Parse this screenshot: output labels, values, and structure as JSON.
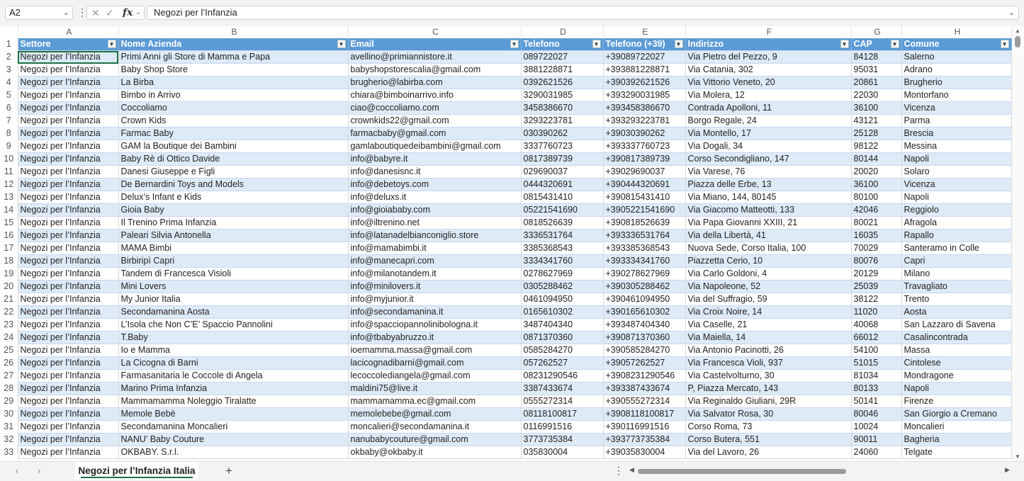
{
  "formula_bar": {
    "cell_ref": "A2",
    "formula": "Negozi per l’Infanzia"
  },
  "columns": [
    "A",
    "B",
    "C",
    "D",
    "E",
    "F",
    "G",
    "H"
  ],
  "header_row_number": "1",
  "headers": [
    "Settore",
    "Nome Azienda",
    "Email",
    "Telefono",
    "Telefono (+39)",
    "Indirizzo",
    "CAP",
    "Comune"
  ],
  "rows": [
    {
      "n": "2",
      "cells": [
        "Negozi per l’Infanzia",
        "Primi Anni gli Store di Mamma e Papa",
        "avellino@primiannistore.it",
        "089722027",
        "+39089722027",
        "Via Pietro del Pezzo, 9",
        "84128",
        "Salerno"
      ]
    },
    {
      "n": "3",
      "cells": [
        "Negozi per l’Infanzia",
        "Baby Shop Store",
        "babyshopstorescalia@gmail.com",
        "3881228871",
        "+393881228871",
        "Via Catania, 302",
        "95031",
        "Adrano"
      ]
    },
    {
      "n": "4",
      "cells": [
        "Negozi per l’Infanzia",
        "La Birba",
        "brugherio@labirba.com",
        "0392621526",
        "+390392621526",
        "Via Vittorio Veneto, 20",
        "20861",
        "Brugherio"
      ]
    },
    {
      "n": "5",
      "cells": [
        "Negozi per l’Infanzia",
        "Bimbo in Arrivo",
        "chiara@bimboinarrivo.info",
        "3290031985",
        "+393290031985",
        "Via Molera, 12",
        "22030",
        "Montorfano"
      ]
    },
    {
      "n": "6",
      "cells": [
        "Negozi per l’Infanzia",
        "Coccoliamo",
        "ciao@coccoliamo.com",
        "3458386670",
        "+393458386670",
        "Contrada Apolloni, 11",
        "36100",
        "Vicenza"
      ]
    },
    {
      "n": "7",
      "cells": [
        "Negozi per l’Infanzia",
        "Crown Kids",
        "crownkids22@gmail.com",
        "3293223781",
        "+393293223781",
        "Borgo Regale, 24",
        "43121",
        "Parma"
      ]
    },
    {
      "n": "8",
      "cells": [
        "Negozi per l’Infanzia",
        "Farmac Baby",
        "farmacbaby@gmail.com",
        "030390262",
        "+39030390262",
        "Via Montello, 17",
        "25128",
        "Brescia"
      ]
    },
    {
      "n": "9",
      "cells": [
        "Negozi per l’Infanzia",
        "GAM la Boutique dei Bambini",
        "gamlaboutiquedeibambini@gmail.com",
        "3337760723",
        "+393337760723",
        "Via Dogali, 34",
        "98122",
        "Messina"
      ]
    },
    {
      "n": "10",
      "cells": [
        "Negozi per l’Infanzia",
        "Baby Rè di Ottico Davide",
        "info@babyre.it",
        "0817389739",
        "+390817389739",
        "Corso Secondigliano, 147",
        "80144",
        "Napoli"
      ]
    },
    {
      "n": "11",
      "cells": [
        "Negozi per l’Infanzia",
        "Danesi Giuseppe e Figli",
        "info@danesisnc.it",
        "029690037",
        "+39029690037",
        "Via Varese, 76",
        "20020",
        "Solaro"
      ]
    },
    {
      "n": "12",
      "cells": [
        "Negozi per l’Infanzia",
        "De Bernardini Toys and Models",
        "info@debetoys.com",
        "0444320691",
        "+390444320691",
        "Piazza delle Erbe, 13",
        "36100",
        "Vicenza"
      ]
    },
    {
      "n": "13",
      "cells": [
        "Negozi per l’Infanzia",
        "Delux’s Infant e Kids",
        "info@deluxs.it",
        "0815431410",
        "+390815431410",
        "Via Miano, 144, 80145",
        "80100",
        "Napoli"
      ]
    },
    {
      "n": "14",
      "cells": [
        "Negozi per l’Infanzia",
        "Gioia Baby",
        "info@gioiababy.com",
        "05221541690",
        "+3905221541690",
        "Via Giacomo Matteotti, 133",
        "42046",
        "Reggiolo"
      ]
    },
    {
      "n": "15",
      "cells": [
        "Negozi per l’Infanzia",
        "Il Trenino Prima Infanzia",
        "info@iltrenino.net",
        "0818526639",
        "+390818526639",
        "Via Papa Giovanni XXIII, 21",
        "80021",
        "Afragola"
      ]
    },
    {
      "n": "16",
      "cells": [
        "Negozi per l’Infanzia",
        "Paleari Silvia Antonella",
        "info@latanadelbianconiglio.store",
        "3336531764",
        "+393336531764",
        "Via della Libertà, 41",
        "16035",
        "Rapallo"
      ]
    },
    {
      "n": "17",
      "cells": [
        "Negozi per l’Infanzia",
        "MAMA Bimbi",
        "info@mamabimbi.it",
        "3385368543",
        "+393385368543",
        "Nuova Sede, Corso Italia, 100",
        "70029",
        "Santeramo in Colle"
      ]
    },
    {
      "n": "18",
      "cells": [
        "Negozi per l’Infanzia",
        "Birbiripì Capri",
        "info@manecapri.com",
        "3334341760",
        "+393334341760",
        "Piazzetta Cerio, 10",
        "80076",
        "Capri"
      ]
    },
    {
      "n": "19",
      "cells": [
        "Negozi per l’Infanzia",
        "Tandem di Francesca Visioli",
        "info@milanotandem.it",
        "0278627969",
        "+390278627969",
        "Via Carlo Goldoni, 4",
        "20129",
        "Milano"
      ]
    },
    {
      "n": "20",
      "cells": [
        "Negozi per l’Infanzia",
        "Mini Lovers",
        "info@minilovers.it",
        "0305288462",
        "+390305288462",
        "Via Napoleone, 52",
        "25039",
        "Travagliato"
      ]
    },
    {
      "n": "21",
      "cells": [
        "Negozi per l’Infanzia",
        "My Junior Italia",
        "info@myjunior.it",
        "0461094950",
        "+390461094950",
        "Via del Suffragio, 59",
        "38122",
        "Trento"
      ]
    },
    {
      "n": "22",
      "cells": [
        "Negozi per l’Infanzia",
        "Secondamanina Aosta",
        "info@secondamanina.it",
        "0165610302",
        "+390165610302",
        "Via Croix Noire, 14",
        "11020",
        "Aosta"
      ]
    },
    {
      "n": "23",
      "cells": [
        "Negozi per l’Infanzia",
        "L’Isola che Non C’E’ Spaccio Pannolini",
        "info@spacciopannolinibologna.it",
        "3487404340",
        "+393487404340",
        "Via Caselle, 21",
        "40068",
        "San Lazzaro di Savena"
      ]
    },
    {
      "n": "24",
      "cells": [
        "Negozi per l’Infanzia",
        "T.Baby",
        "info@tbabyabruzzo.it",
        "0871370360",
        "+390871370360",
        "Via Maiella, 14",
        "66012",
        "Casalincontrada"
      ]
    },
    {
      "n": "25",
      "cells": [
        "Negozi per l’Infanzia",
        "Io e Mamma",
        "ioemamma.massa@gmail.com",
        "0585284270",
        "+390585284270",
        "Via Antonio Pacinotti, 26",
        "54100",
        "Massa"
      ]
    },
    {
      "n": "26",
      "cells": [
        "Negozi per l’Infanzia",
        "La Cicogna di Barni",
        "lacicognadibarni@gmail.com",
        "057262527",
        "+39057262527",
        "Via Francesca Violi, 937",
        "51015",
        "Cintolese"
      ]
    },
    {
      "n": "27",
      "cells": [
        "Negozi per l’Infanzia",
        "Farmasanitaria le Coccole di Angela",
        "lecoccolediangela@gmail.com",
        "08231290546",
        "+3908231290546",
        "Via Castelvolturno, 30",
        "81034",
        "Mondragone"
      ]
    },
    {
      "n": "28",
      "cells": [
        "Negozi per l’Infanzia",
        "Marino Prima Infanzia",
        "maldini75@live.it",
        "3387433674",
        "+393387433674",
        "P, Piazza Mercato, 143",
        "80133",
        "Napoli"
      ]
    },
    {
      "n": "29",
      "cells": [
        "Negozi per l’Infanzia",
        "Mammamamma Noleggio Tiralatte",
        "mammamamma.ec@gmail.com",
        "0555272314",
        "+390555272314",
        "Via Reginaldo Giuliani, 29R",
        "50141",
        "Firenze"
      ]
    },
    {
      "n": "30",
      "cells": [
        "Negozi per l’Infanzia",
        "Memole Bebè",
        "memolebebe@gmail.com",
        "08118100817",
        "+3908118100817",
        "Via Salvator Rosa, 30",
        "80046",
        "San Giorgio a Cremano"
      ]
    },
    {
      "n": "31",
      "cells": [
        "Negozi per l’Infanzia",
        "Secondamanina Moncalieri",
        "moncalieri@secondamanina.it",
        "0116991516",
        "+390116991516",
        "Corso Roma, 73",
        "10024",
        "Moncalieri"
      ]
    },
    {
      "n": "32",
      "cells": [
        "Negozi per l’Infanzia",
        "NANU’ Baby Couture",
        "nanubabycouture@gmail.com",
        "3773735384",
        "+393773735384",
        "Corso Butera, 551",
        "90011",
        "Bagheria"
      ]
    },
    {
      "n": "33",
      "cells": [
        "Negozi per l’Infanzia",
        "OKBABY. S.r.l.",
        "okbaby@okbaby.it",
        "035830004",
        "+39035830004",
        "Via del Lavoro, 26",
        "24060",
        "Telgate"
      ]
    }
  ],
  "sheet_tab": {
    "name": "Negozi per l’Infanzia Italia"
  },
  "colors": {
    "header_fill": "#5b9bd5",
    "band_fill": "#ddebf7",
    "active_tab": "#1e7145"
  }
}
